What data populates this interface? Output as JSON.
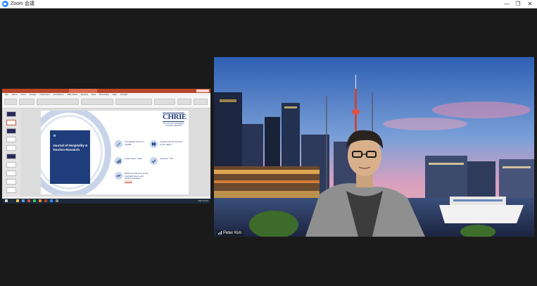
{
  "window": {
    "title": "Zoom 会議",
    "controls": {
      "minimize": "—",
      "maximize": "❐",
      "close": "✕"
    }
  },
  "share": {
    "menu": [
      "File",
      "Home",
      "Insert",
      "Design",
      "Transitions",
      "Animations",
      "Slide Show",
      "Review",
      "View",
      "Recording",
      "Help",
      "Acrobat"
    ],
    "slide": {
      "cover_title": "Journal of Hospitality & Tourism Research",
      "logo": "CHRIE",
      "logo_sub": "The Journal of Hospitality & Tourism Research",
      "features": [
        {
          "icon": "pen-icon",
          "text": "The flagship journal of ICHRIE"
        },
        {
          "icon": "book-icon",
          "text": "A legacy journal: 45 years in the making"
        },
        {
          "icon": "chart-icon",
          "text": "Impact factor: 3.361"
        },
        {
          "icon": "check-icon",
          "text": "Citescore: 7.04"
        },
        {
          "icon": "rank-icon",
          "text": "Ranked as 22nd out of 124 hospitality leisure and tourism journals by",
          "highlight": "Scimago"
        }
      ]
    },
    "taskbar": {
      "clock": "2021/11/02",
      "icon_colors": [
        "#f2c94c",
        "#4aa3ff",
        "#e04a3a",
        "#3ec46d",
        "#ff8a3d",
        "#b7472a",
        "#2d8cff",
        "#8e8e8e"
      ]
    }
  },
  "video": {
    "participant_name": "Peter Kim"
  },
  "colors": {
    "zoom_blue": "#2d8cff",
    "powerpoint_red": "#b7472a",
    "journal_navy": "#1f3d7a",
    "accent_light": "#c9d4ea"
  }
}
